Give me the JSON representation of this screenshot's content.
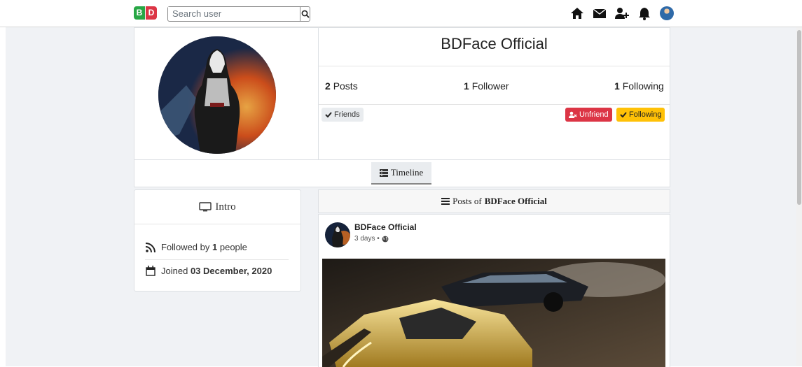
{
  "logo": {
    "left": "B",
    "right": "D"
  },
  "search": {
    "placeholder": "Search user"
  },
  "nav_icons": [
    "home-icon",
    "envelope-icon",
    "add-friend-icon",
    "bell-icon",
    "avatar"
  ],
  "profile": {
    "name": "BDFace Official",
    "stats": {
      "posts_count": "2",
      "posts_label": "Posts",
      "followers_count": "1",
      "followers_label": "Follower",
      "following_count": "1",
      "following_label": "Following"
    },
    "buttons": {
      "friends": "Friends",
      "unfriend": "Unfriend",
      "following": "Following"
    }
  },
  "tabs": {
    "timeline": "Timeline"
  },
  "intro": {
    "title": "Intro",
    "followed_prefix": "Followed by",
    "followed_count": "1",
    "followed_suffix": "people",
    "joined_prefix": "Joined",
    "joined_date": "03 December, 2020"
  },
  "posts": {
    "header_prefix": "Posts of",
    "header_name": "BDFace Official",
    "items": [
      {
        "author": "BDFace Official",
        "time": "3 days •",
        "privacy_icon": "globe-icon"
      }
    ]
  },
  "colors": {
    "danger": "#dc3545",
    "warning": "#ffc107",
    "success": "#28a745"
  }
}
